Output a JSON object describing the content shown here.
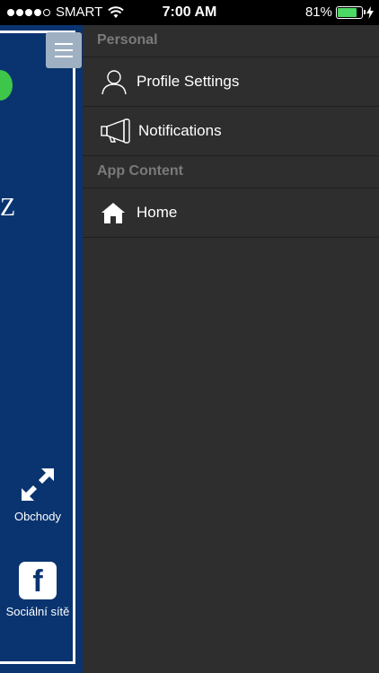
{
  "status_bar": {
    "carrier": "SMART",
    "time": "7:00 AM",
    "battery_percent": "81%",
    "battery_level": 0.81,
    "signal_bars_filled": 4,
    "signal_bars_total": 5
  },
  "app_panel": {
    "partial_text": "Z",
    "tiles": [
      {
        "label": "Obchody",
        "icon": "expand-arrows-icon"
      },
      {
        "label": "Sociální sítě",
        "icon": "facebook-icon"
      }
    ],
    "facebook_glyph": "f"
  },
  "drawer": {
    "sections": [
      {
        "title": "Personal",
        "items": [
          {
            "label": "Profile Settings",
            "icon": "user-icon"
          },
          {
            "label": "Notifications",
            "icon": "megaphone-icon"
          }
        ]
      },
      {
        "title": "App Content",
        "items": [
          {
            "label": "Home",
            "icon": "home-icon"
          }
        ]
      }
    ]
  },
  "colors": {
    "drawer_bg": "#2e2e2e",
    "app_bg": "#0a3470",
    "battery": "#4cd964",
    "accent_green": "#3ec64a"
  }
}
